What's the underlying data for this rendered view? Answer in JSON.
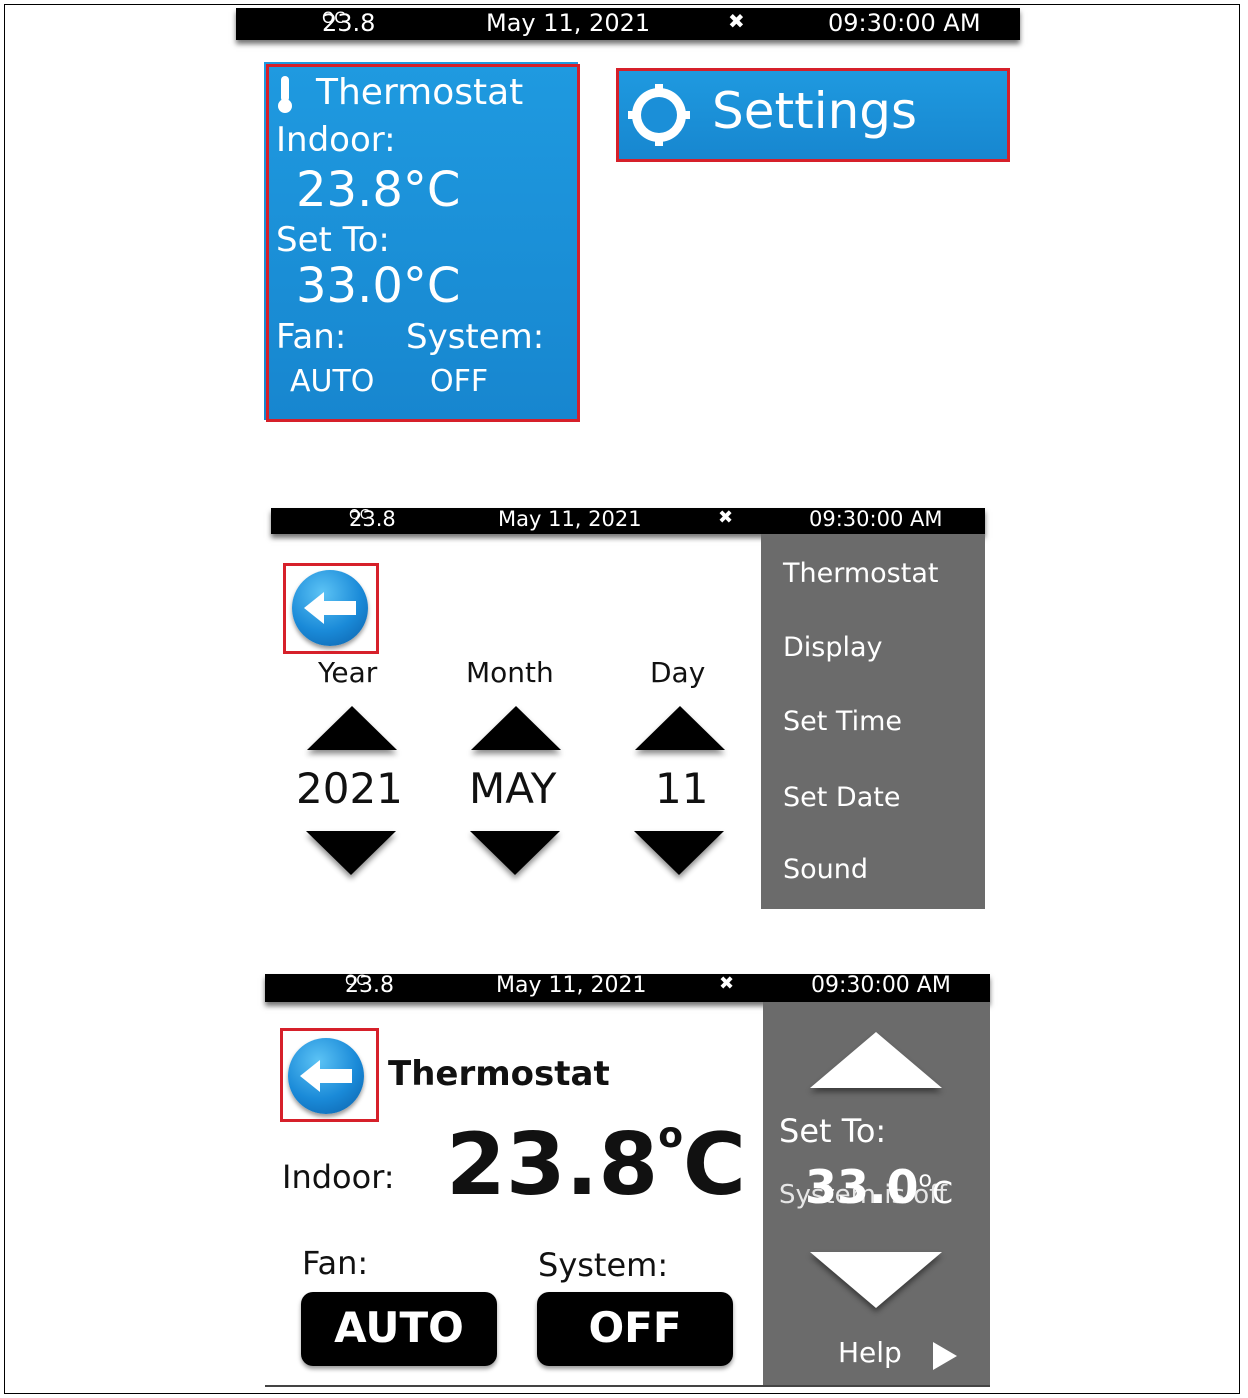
{
  "status": {
    "temp": "23.8",
    "temp_unit": "OC",
    "date": "May 11, 2021",
    "fan_glyph": "✖",
    "time": "09:30:00 AM"
  },
  "home": {
    "thermostat_tile": {
      "title": "Thermostat",
      "indoor_label": "Indoor:",
      "indoor_value": "23.8°C",
      "setto_label": "Set To:",
      "setto_value": "33.0°C",
      "fan_label": "Fan:",
      "system_label": "System:",
      "fan_value": "AUTO",
      "system_value": "OFF"
    },
    "settings_tile": {
      "label": "Settings"
    }
  },
  "set_date": {
    "columns": [
      {
        "label": "Year",
        "value": "2021"
      },
      {
        "label": "Month",
        "value": "MAY"
      },
      {
        "label": "Day",
        "value": "11"
      }
    ],
    "menu": [
      "Thermostat",
      "Display",
      "Set Time",
      "Set Date",
      "Sound"
    ]
  },
  "thermostat": {
    "title": "Thermostat",
    "indoor_label": "Indoor:",
    "indoor_value": "23.8",
    "indoor_deg": "o",
    "indoor_unit": "C",
    "fan_label": "Fan:",
    "system_label": "System:",
    "fan_button": "AUTO",
    "system_button": "OFF",
    "setto_label": "Set To:",
    "setto_value": "33.0",
    "setto_deg": "o",
    "setto_unit": "C",
    "system_status": "System is off",
    "help_label": "Help"
  },
  "colors": {
    "tile_blue": "#1b8fd8",
    "highlight_red": "#d6202a",
    "menu_gray": "#6b6b6b"
  }
}
